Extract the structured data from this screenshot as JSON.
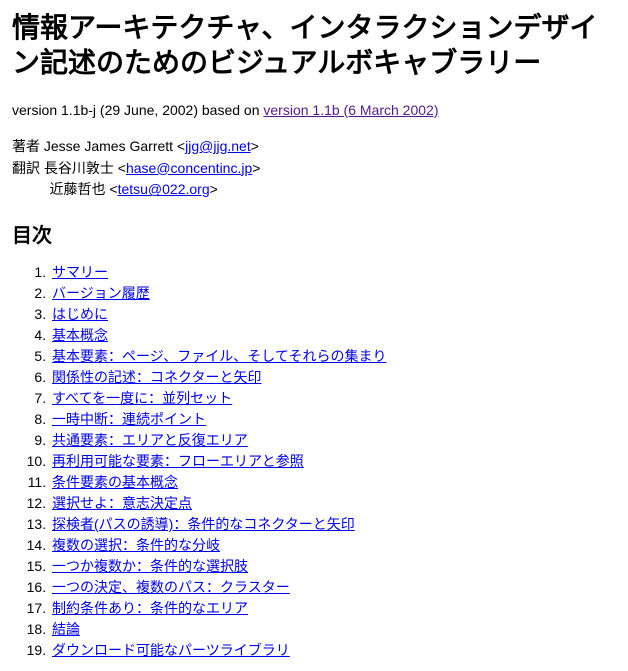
{
  "title": "情報アーキテクチャ、インタラクションデザイン記述のためのビジュアルボキャブラリー",
  "version_line": {
    "prefix": "version 1.1b-j (29 June, 2002) based on ",
    "link_text": "version 1.1b (6 March 2002)"
  },
  "credits": [
    {
      "role": "著者",
      "name": "Jesse James Garrett",
      "email": "jjg@jjg.net"
    },
    {
      "role": "翻訳",
      "name": "長谷川敦士",
      "email": "hase@concentinc.jp"
    },
    {
      "role": "",
      "name": "近藤哲也",
      "email": "tetsu@022.org"
    }
  ],
  "toc_heading": "目次",
  "toc": [
    "サマリー",
    "バージョン履歴",
    "はじめに",
    "基本概念",
    "基本要素：ページ、ファイル、そしてそれらの集まり",
    "関係性の記述：コネクターと矢印",
    "すべてを一度に：並列セット",
    "一時中断：連続ポイント",
    "共通要素：エリアと反復エリア",
    "再利用可能な要素：フローエリアと参照",
    "条件要素の基本概念",
    "選択せよ：意志決定点",
    "探検者(パスの誘導)：条件的なコネクターと矢印",
    "複数の選択：条件的な分岐",
    "一つか複数か：条件的な選択肢",
    "一つの決定、複数のパス：クラスター",
    "制約条件あり：条件的なエリア",
    "結論",
    "ダウンロード可能なパーツライブラリ"
  ]
}
